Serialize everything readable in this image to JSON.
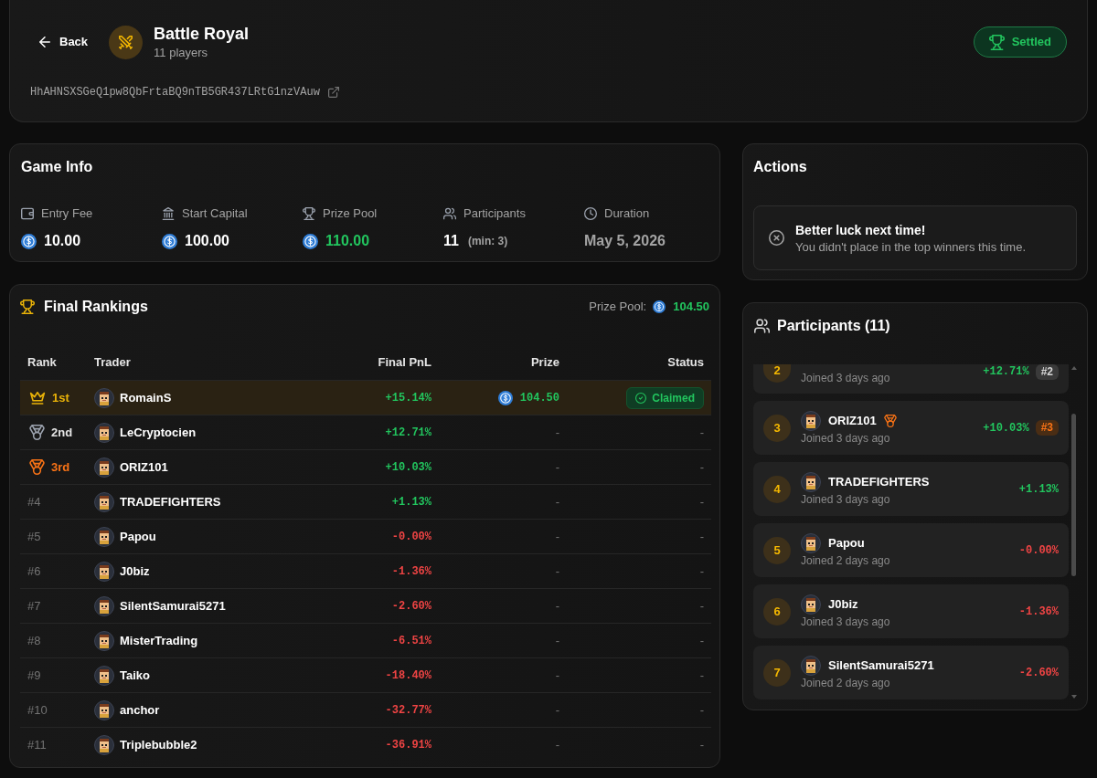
{
  "header": {
    "back": "Back",
    "title": "Battle Royal",
    "subtitle": "11 players",
    "address": "HhAHNSXSGeQ1pw8QbFrtaBQ9nTB5GR437LRtG1nzVAuw",
    "status": "Settled"
  },
  "game_info": {
    "title": "Game Info",
    "stats": [
      {
        "kind": "amount",
        "label": "Entry Fee",
        "value": "10.00"
      },
      {
        "kind": "amount",
        "label": "Start Capital",
        "value": "100.00"
      },
      {
        "kind": "prize",
        "label": "Prize Pool",
        "value": "110.00"
      },
      {
        "kind": "count",
        "label": "Participants",
        "value": "11",
        "note": "(min: 3)"
      },
      {
        "kind": "date",
        "label": "Duration",
        "value": "May 5, 2026"
      }
    ]
  },
  "rankings": {
    "title": "Final Rankings",
    "prize_pool_label": "Prize Pool:",
    "prize_pool_value": "104.50",
    "columns": [
      "Rank",
      "Trader",
      "Final PnL",
      "Prize",
      "Status"
    ],
    "rows": [
      {
        "kind": "gold",
        "highlighted": true,
        "rank": "1st",
        "trader": "RomainS",
        "pnl": "+15.14%",
        "gain": true,
        "prize": "104.50",
        "prize_paid": true,
        "status": "Claimed",
        "claimed": true
      },
      {
        "kind": "silver",
        "highlighted": false,
        "rank": "2nd",
        "trader": "LeCryptocien",
        "pnl": "+12.71%",
        "gain": true,
        "prize": "-",
        "prize_paid": false,
        "status": "-",
        "claimed": false
      },
      {
        "kind": "bronze",
        "highlighted": false,
        "rank": "3rd",
        "trader": "ORIZ101",
        "pnl": "+10.03%",
        "gain": true,
        "prize": "-",
        "prize_paid": false,
        "status": "-",
        "claimed": false
      },
      {
        "kind": "plain",
        "highlighted": false,
        "rank": "#4",
        "trader": "TRADEFIGHTERS",
        "pnl": "+1.13%",
        "gain": true,
        "prize": "-",
        "prize_paid": false,
        "status": "-",
        "claimed": false
      },
      {
        "kind": "plain",
        "highlighted": false,
        "rank": "#5",
        "trader": "Papou",
        "pnl": "-0.00%",
        "gain": false,
        "prize": "-",
        "prize_paid": false,
        "status": "-",
        "claimed": false
      },
      {
        "kind": "plain",
        "highlighted": false,
        "rank": "#6",
        "trader": "J0biz",
        "pnl": "-1.36%",
        "gain": false,
        "prize": "-",
        "prize_paid": false,
        "status": "-",
        "claimed": false
      },
      {
        "kind": "plain",
        "highlighted": false,
        "rank": "#7",
        "trader": "SilentSamurai5271",
        "pnl": "-2.60%",
        "gain": false,
        "prize": "-",
        "prize_paid": false,
        "status": "-",
        "claimed": false
      },
      {
        "kind": "plain",
        "highlighted": false,
        "rank": "#8",
        "trader": "MisterTrading",
        "pnl": "-6.51%",
        "gain": false,
        "prize": "-",
        "prize_paid": false,
        "status": "-",
        "claimed": false
      },
      {
        "kind": "plain",
        "highlighted": false,
        "rank": "#9",
        "trader": "Taiko",
        "pnl": "-18.40%",
        "gain": false,
        "prize": "-",
        "prize_paid": false,
        "status": "-",
        "claimed": false
      },
      {
        "kind": "plain",
        "highlighted": false,
        "rank": "#10",
        "trader": "anchor",
        "pnl": "-32.77%",
        "gain": false,
        "prize": "-",
        "prize_paid": false,
        "status": "-",
        "claimed": false
      },
      {
        "kind": "plain",
        "highlighted": false,
        "rank": "#11",
        "trader": "Triplebubble2",
        "pnl": "-36.91%",
        "gain": false,
        "prize": "-",
        "prize_paid": false,
        "status": "-",
        "claimed": false
      }
    ]
  },
  "actions": {
    "title": "Actions",
    "notice": {
      "title": "Better luck next time!",
      "text": "You didn't place in the top winners this time."
    }
  },
  "participants": {
    "title": "Participants (11)",
    "items": [
      {
        "kind": "silver",
        "rank": "2",
        "joined": "Joined 3 days ago",
        "pnl": "+12.71%",
        "gain": true,
        "badge": "#2"
      },
      {
        "kind": "bronze",
        "rank": "3",
        "name": "ORIZ101",
        "joined": "Joined 3 days ago",
        "pnl": "+10.03%",
        "gain": true,
        "badge": "#3"
      },
      {
        "kind": "plain",
        "rank": "4",
        "name": "TRADEFIGHTERS",
        "joined": "Joined 3 days ago",
        "pnl": "+1.13%",
        "gain": true
      },
      {
        "kind": "plain",
        "rank": "5",
        "name": "Papou",
        "joined": "Joined 2 days ago",
        "pnl": "-0.00%",
        "gain": false
      },
      {
        "kind": "plain",
        "rank": "6",
        "name": "J0biz",
        "joined": "Joined 3 days ago",
        "pnl": "-1.36%",
        "gain": false
      },
      {
        "kind": "plain",
        "rank": "7",
        "name": "SilentSamurai5271",
        "joined": "Joined 2 days ago",
        "pnl": "-2.60%",
        "gain": false
      }
    ]
  }
}
